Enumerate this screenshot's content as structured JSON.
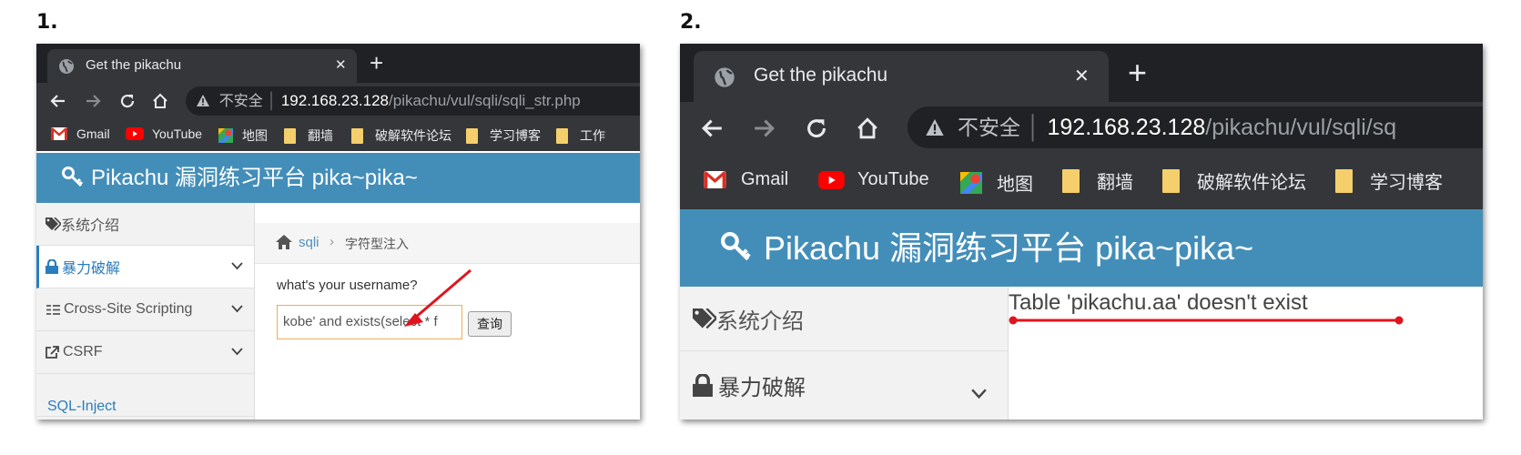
{
  "steps": [
    "1.",
    "2."
  ],
  "browser": {
    "tab_title": "Get the pikachu",
    "new_tab_label": "+",
    "close_label": "✕",
    "security_label": "不安全",
    "url_host": "192.168.23.128",
    "url_path_1": "/pikachu/vul/sqli/sqli_str.php",
    "url_path_2": "/pikachu/vul/sqli/sq",
    "bookmarks": [
      "Gmail",
      "YouTube",
      "地图",
      "翻墙",
      "破解软件论坛",
      "学习博客",
      "工作"
    ]
  },
  "site": {
    "banner_title": "Pikachu 漏洞练习平台 pika~pika~",
    "sidebar": [
      "系统介绍",
      "暴力破解",
      "Cross-Site Scripting",
      "CSRF",
      "SQL-Inject"
    ],
    "breadcrumb": {
      "section": "sqli",
      "sep": "›",
      "page": "字符型注入"
    }
  },
  "form": {
    "question": "what's your username?",
    "input_value": "kobe' and exists(select * f",
    "submit_label": "查询"
  },
  "result": {
    "error_message": "Table 'pikachu.aa' doesn't exist"
  },
  "colors": {
    "banner": "#438eb9",
    "annotation": "#e0141e",
    "input_border": "#f0ad4e"
  }
}
